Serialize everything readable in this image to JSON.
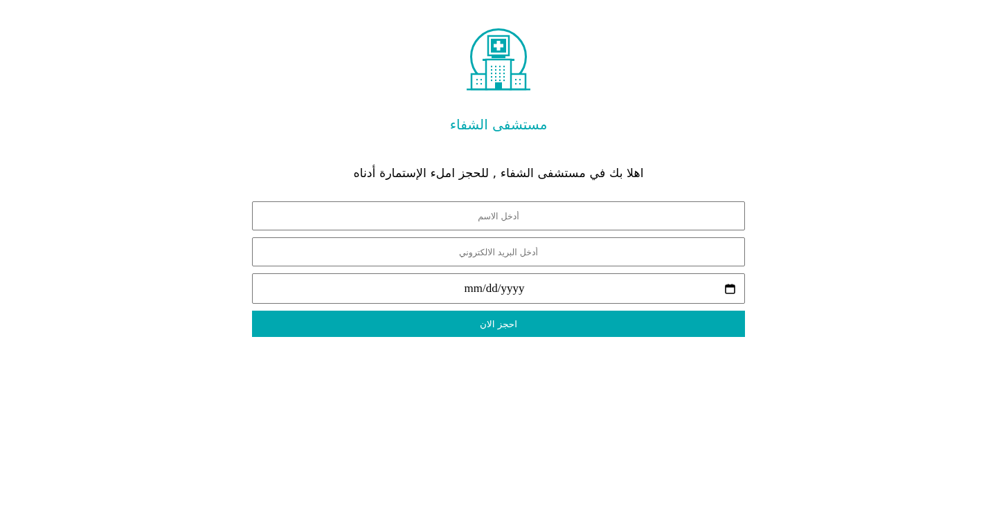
{
  "hospital_name": "مستشفى الشفاء",
  "welcome": "اهلا بك في مستشفى الشفاء , للحجز املء الإستمارة أدناه",
  "form": {
    "fields": [
      {
        "kind": "text",
        "placeholder": "أدخل الاسم"
      },
      {
        "kind": "text",
        "placeholder": "أدخل البريد الالكتروني"
      },
      {
        "kind": "date",
        "placeholder": "mm/dd/yyyy"
      }
    ],
    "submit": "احجز الان"
  }
}
